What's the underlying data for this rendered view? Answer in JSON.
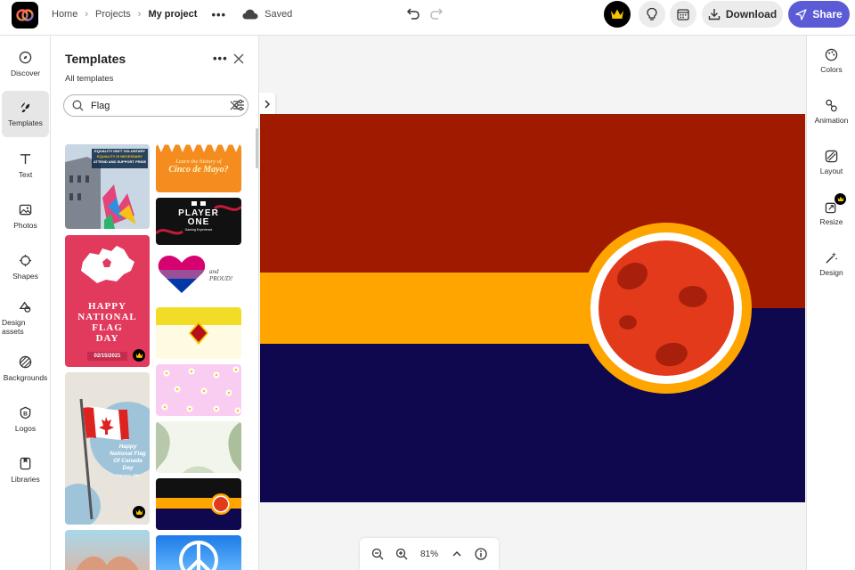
{
  "breadcrumb": {
    "home": "Home",
    "projects": "Projects",
    "current": "My project",
    "status": "Saved"
  },
  "toolbar": {
    "download_label": "Download",
    "share_label": "Share"
  },
  "left_rail": {
    "items": [
      {
        "label": "Discover",
        "icon": "compass-icon"
      },
      {
        "label": "Templates",
        "icon": "templates-icon"
      },
      {
        "label": "Text",
        "icon": "text-icon"
      },
      {
        "label": "Photos",
        "icon": "photo-icon"
      },
      {
        "label": "Shapes",
        "icon": "shapes-icon"
      },
      {
        "label": "Design assets",
        "icon": "design-assets-icon"
      },
      {
        "label": "Backgrounds",
        "icon": "backgrounds-icon"
      },
      {
        "label": "Logos",
        "icon": "logo-icon"
      },
      {
        "label": "Libraries",
        "icon": "libraries-icon"
      }
    ],
    "active": "Templates"
  },
  "panel": {
    "title": "Templates",
    "subtitle": "All templates",
    "search_value": "Flag"
  },
  "templates": {
    "equality": {
      "line1": "EQUALITY ISN'T VOLUNTARY",
      "line2": "EQUALITY IS NECESSARY",
      "line3": "ATTEND AND SUPPORT PRIDE"
    },
    "cinco": {
      "line1": "Learn the history of",
      "line2": "Cinco de Mayo?"
    },
    "player": {
      "line1": "PLAYER",
      "line2": "ONE",
      "line3": "Gaming Experience"
    },
    "proud": {
      "text": "and PROUD!"
    },
    "flag_day": {
      "line1": "HAPPY",
      "line2": "NATIONAL",
      "line3": "FLAG",
      "line4": "DAY",
      "date": "02/15/2021"
    },
    "canada": {
      "line1": "Happy",
      "line2": "National Flag",
      "line3": "Of Canada Day",
      "line4": "February 15th"
    }
  },
  "right_rail": {
    "items": [
      {
        "label": "Colors",
        "icon": "palette-icon"
      },
      {
        "label": "Animation",
        "icon": "animation-icon"
      },
      {
        "label": "Layout",
        "icon": "layout-icon"
      },
      {
        "label": "Resize",
        "icon": "resize-icon",
        "premium": true
      },
      {
        "label": "Design",
        "icon": "magic-wand-icon"
      }
    ]
  },
  "zoom": {
    "level": "81%"
  },
  "colors": {
    "accent": "#5b5bd6",
    "flag_red": "#a01a00",
    "flag_orange": "#ffa500",
    "flag_navy": "#10084e",
    "moon": "#e33a1c",
    "crown": "#f7c300"
  }
}
